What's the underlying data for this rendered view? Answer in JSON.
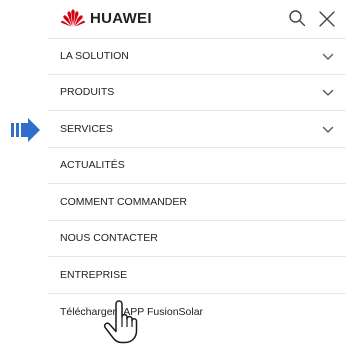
{
  "header": {
    "brand": "HUAWEI",
    "brand_icon": "huawei-flower-logo",
    "search_icon": "search-icon",
    "close_icon": "close-icon"
  },
  "menu": {
    "items": [
      {
        "label": "LA SOLUTION",
        "expandable": true
      },
      {
        "label": "PRODUITS",
        "expandable": true
      },
      {
        "label": "SERVICES",
        "expandable": true
      },
      {
        "label": "ACTUALITÉS",
        "expandable": false
      },
      {
        "label": "COMMENT COMMANDER",
        "expandable": false
      },
      {
        "label": "NOUS CONTACTER",
        "expandable": false
      },
      {
        "label": "ENTREPRISE",
        "expandable": false
      },
      {
        "label": "Télécharger l'APP FusionSolar",
        "expandable": false
      }
    ]
  },
  "annotations": {
    "arrow_color": "#2f6ecb",
    "highlighted_item": "SERVICES",
    "hand_cursor_icon": "hand-pointer-icon"
  },
  "colors": {
    "brand_red": "#d7000f",
    "divider": "#e6e6e6",
    "text": "#222222"
  }
}
